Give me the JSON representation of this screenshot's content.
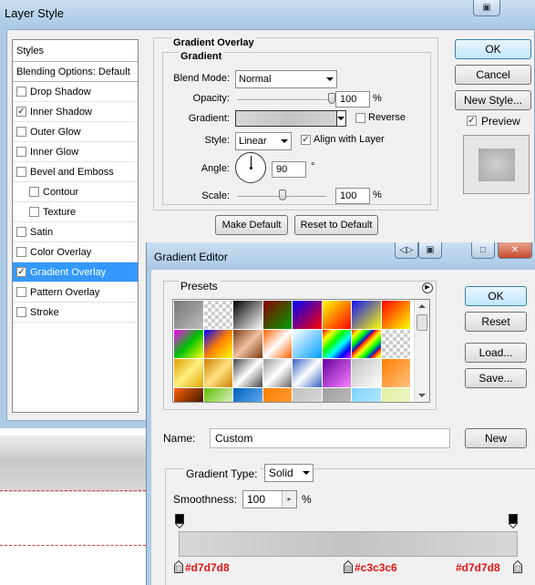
{
  "layer_style": {
    "title": "Layer Style",
    "styles_header": "Styles",
    "blending_options": "Blending Options: Default",
    "styles": [
      {
        "label": "Drop Shadow",
        "checked": false,
        "sub": false,
        "selected": false
      },
      {
        "label": "Inner Shadow",
        "checked": true,
        "sub": false,
        "selected": false
      },
      {
        "label": "Outer Glow",
        "checked": false,
        "sub": false,
        "selected": false
      },
      {
        "label": "Inner Glow",
        "checked": false,
        "sub": false,
        "selected": false
      },
      {
        "label": "Bevel and Emboss",
        "checked": false,
        "sub": false,
        "selected": false
      },
      {
        "label": "Contour",
        "checked": false,
        "sub": true,
        "selected": false
      },
      {
        "label": "Texture",
        "checked": false,
        "sub": true,
        "selected": false
      },
      {
        "label": "Satin",
        "checked": false,
        "sub": false,
        "selected": false
      },
      {
        "label": "Color Overlay",
        "checked": false,
        "sub": false,
        "selected": false
      },
      {
        "label": "Gradient Overlay",
        "checked": true,
        "sub": false,
        "selected": true
      },
      {
        "label": "Pattern Overlay",
        "checked": false,
        "sub": false,
        "selected": false
      },
      {
        "label": "Stroke",
        "checked": false,
        "sub": false,
        "selected": false
      }
    ],
    "gradient_overlay": {
      "group_title": "Gradient Overlay",
      "sub_title": "Gradient",
      "blend_mode_label": "Blend Mode:",
      "blend_mode": "Normal",
      "opacity_label": "Opacity:",
      "opacity": "100",
      "opacity_fraction": 1.0,
      "percent": "%",
      "gradient_label": "Gradient:",
      "reverse_label": "Reverse",
      "reverse_checked": false,
      "style_label": "Style:",
      "style": "Linear",
      "align_label": "Align with Layer",
      "align_checked": true,
      "angle_label": "Angle:",
      "angle": "90",
      "degree": "°",
      "scale_label": "Scale:",
      "scale": "100",
      "scale_fraction": 0.5,
      "make_default": "Make Default",
      "reset_default": "Reset to Default"
    },
    "buttons": {
      "ok": "OK",
      "cancel": "Cancel",
      "new_style": "New Style...",
      "preview_label": "Preview",
      "preview_checked": true
    }
  },
  "gradient_editor": {
    "title": "Gradient Editor",
    "presets_title": "Presets",
    "name_label": "Name:",
    "name_value": "Custom",
    "new_button": "New",
    "ok": "OK",
    "reset": "Reset",
    "load": "Load...",
    "save": "Save...",
    "gradient_type_label": "Gradient Type:",
    "gradient_type": "Solid",
    "smoothness_label": "Smoothness:",
    "smoothness": "100",
    "percent": "%",
    "stops": [
      {
        "hex": "#d7d7d8",
        "position": 0
      },
      {
        "hex": "#c3c3c6",
        "position": 50
      },
      {
        "hex": "#d7d7d8",
        "position": 100
      }
    ],
    "colors": {
      "stop_label": "#e01414"
    }
  }
}
